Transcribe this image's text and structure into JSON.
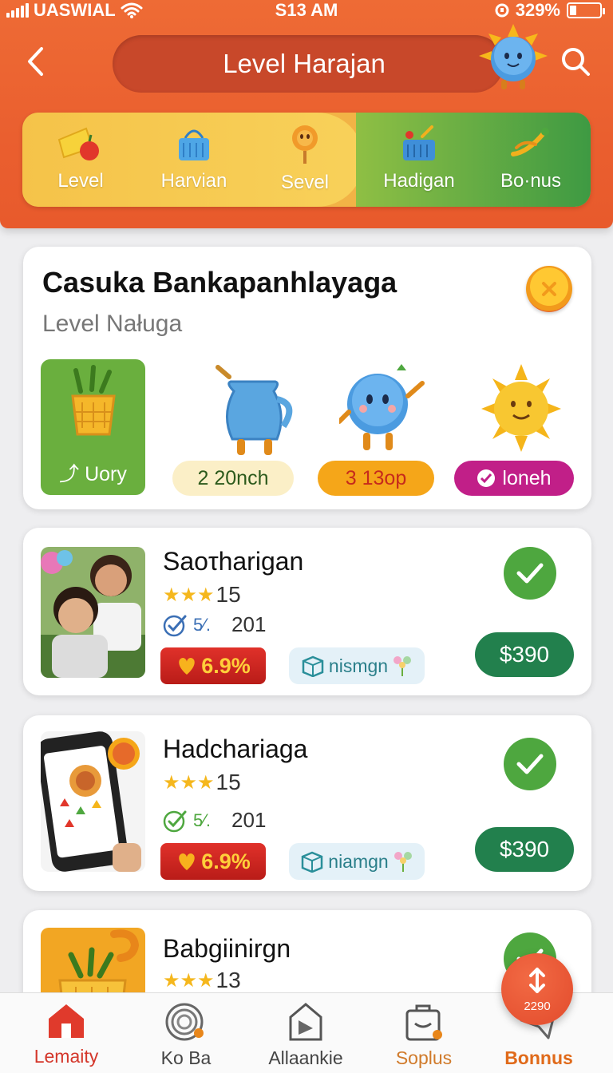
{
  "status_bar": {
    "carrier": "UASWIAL",
    "time": "S13 AM",
    "battery": "329%"
  },
  "header": {
    "title": "Level Harajan"
  },
  "tabs": [
    {
      "label": "Level",
      "icon": "cheese-apple-icon"
    },
    {
      "label": "Harvian",
      "icon": "basket-icon"
    },
    {
      "label": "Sevel",
      "icon": "lollipop-icon"
    },
    {
      "label": "Hadigan",
      "icon": "shopping-basket-icon"
    },
    {
      "label": "Bo·nus",
      "icon": "horn-icon"
    }
  ],
  "featured": {
    "title": "Casuka Bankapanhlayaga",
    "subtitle": "Level Naługa",
    "tile_label": "Uory",
    "badges": [
      "2 20nch",
      "3 13op",
      "loneh"
    ]
  },
  "items": [
    {
      "title": "Saoτharigan",
      "rating": "15",
      "check_pct": "5⁄.",
      "count": "201",
      "discount": "6.9%",
      "tag": "nismgn",
      "price": "$390"
    },
    {
      "title": "Hadchariaga",
      "rating": "15",
      "check_pct": "5⁄.",
      "count": "201",
      "discount": "6.9%",
      "tag": "niamgn",
      "price": "$390"
    },
    {
      "title": "Babgiinirgn",
      "rating": "13"
    }
  ],
  "bottom_nav": [
    {
      "label": "Lemaity",
      "icon": "home-icon"
    },
    {
      "label": "Ko Ba",
      "icon": "fingerprint-icon"
    },
    {
      "label": "Allaankie",
      "icon": "document-icon"
    },
    {
      "label": "Soplus",
      "icon": "bag-icon"
    },
    {
      "label": "Bonnus",
      "icon": "paper-plane-icon"
    }
  ],
  "fab": {
    "value": "2290",
    "icon": "arrow-up-down-icon"
  },
  "colors": {
    "header": "#ea5f2f",
    "accent_green": "#4ea73f",
    "price_green": "#22804d",
    "discount_red": "#c9221d"
  }
}
